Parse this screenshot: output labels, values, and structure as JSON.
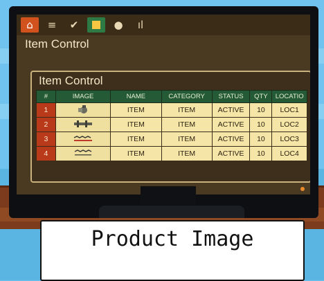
{
  "toolbar": {
    "buttons": [
      {
        "icon": "home-icon",
        "glyph": "⌂"
      },
      {
        "icon": "menu-icon",
        "glyph": "≡"
      },
      {
        "icon": "check-icon",
        "glyph": "✔"
      },
      {
        "icon": "square-icon",
        "glyph": ""
      },
      {
        "icon": "user-icon",
        "glyph": "●"
      },
      {
        "icon": "bar-chart-icon",
        "glyph": "ıl"
      }
    ]
  },
  "app": {
    "title": "Item Control"
  },
  "panel": {
    "title": "Item Control",
    "columns": [
      "#",
      "IMAGE",
      "NAME",
      "CATEGORY",
      "STATUS",
      "QTY",
      "LOCATIO"
    ],
    "rows": [
      {
        "num": "1",
        "image": "product-image-1-icon",
        "name": "ITEM",
        "category": "ITEM",
        "status": "ACTIVE",
        "qty": "10",
        "location": "LOC1"
      },
      {
        "num": "2",
        "image": "product-image-2-icon",
        "name": "ITEM",
        "category": "ITEM",
        "status": "ACTIVE",
        "qty": "10",
        "location": "LOC2"
      },
      {
        "num": "3",
        "image": "product-image-3-icon",
        "name": "ITEM",
        "category": "ITEM",
        "status": "ACTIVE",
        "qty": "10",
        "location": "LOC3"
      },
      {
        "num": "4",
        "image": "product-image-4-icon",
        "name": "ITEM",
        "category": "ITEM",
        "status": "ACTIVE",
        "qty": "10",
        "location": "LOC4"
      }
    ]
  },
  "caption": {
    "text": "Product Image"
  },
  "colors": {
    "accent_home": "#d2521e",
    "header_green": "#255a36",
    "cell_cream": "#f5e5a6",
    "row_number_red": "#b83a1a"
  }
}
